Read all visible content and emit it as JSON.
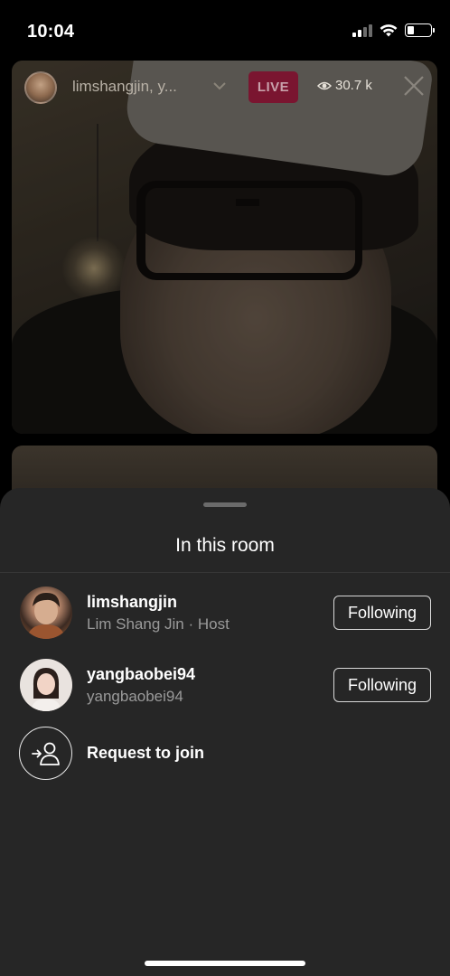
{
  "status_bar": {
    "time": "10:04",
    "icons": [
      "cellular-signal-icon",
      "wifi-icon",
      "battery-icon"
    ]
  },
  "live": {
    "host_names": "limshangjin, y...",
    "live_badge": "LIVE",
    "viewer_count": "30.7 k",
    "icons": [
      "host-avatar",
      "chevron-down-icon",
      "eye-icon",
      "close-icon"
    ]
  },
  "sheet": {
    "title": "In this room",
    "participants": [
      {
        "username": "limshangjin",
        "subtitle": "Lim Shang Jin · Host",
        "button_label": "Following"
      },
      {
        "username": "yangbaobei94",
        "subtitle": "yangbaobei94",
        "button_label": "Following"
      }
    ],
    "request_label": "Request to join",
    "request_icon": "add-person-icon"
  },
  "colors": {
    "sheet_bg": "#262626",
    "live_badge_bg": "#7a1530",
    "subtitle_gray": "#9a9a9a",
    "text_white": "#ffffff"
  }
}
